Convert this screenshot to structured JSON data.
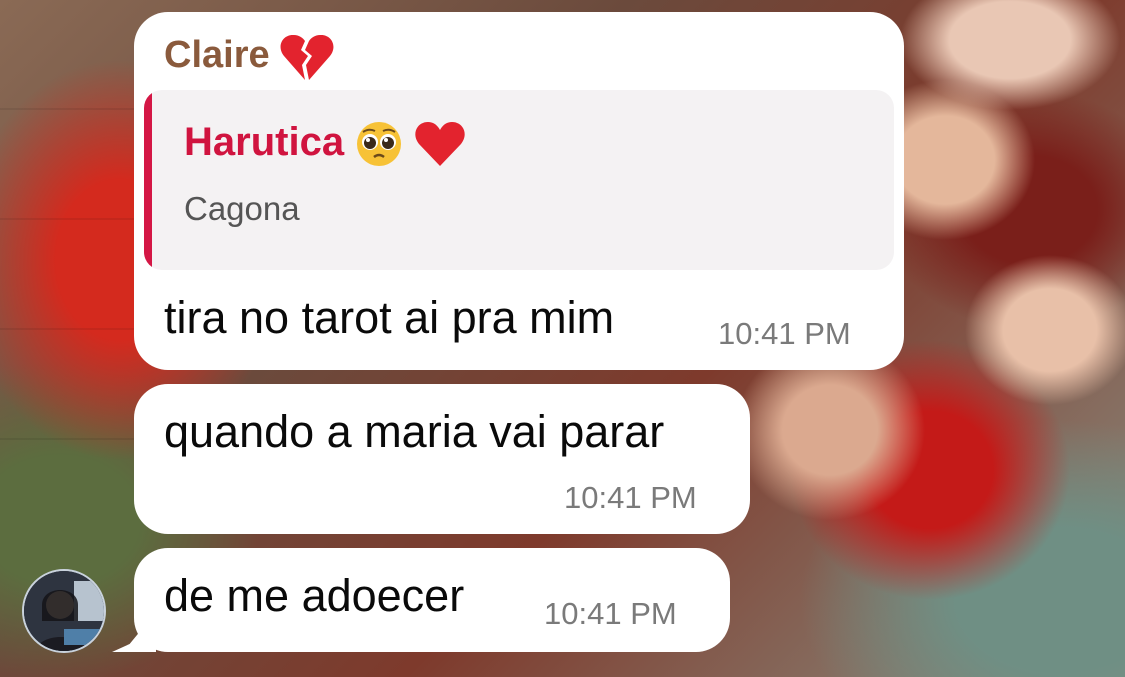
{
  "background": {
    "accent_red": "#c41a18",
    "sender_color": "#8a5a3c",
    "reply_color": "#d0143f"
  },
  "messages": [
    {
      "sender": "Claire",
      "sender_emoji_icon": "broken-heart-icon",
      "reply_to": {
        "author": "Harutica",
        "author_emoji_icons": [
          "pleading-face-icon",
          "red-heart-icon"
        ],
        "text": "Cagona"
      },
      "text": "tira no tarot ai pra mim",
      "time": "10:41 PM"
    },
    {
      "text": "quando a maria vai parar",
      "time": "10:41 PM"
    },
    {
      "text": "de me adoecer",
      "time": "10:41 PM"
    }
  ],
  "avatar": {
    "icon": "user-avatar"
  }
}
